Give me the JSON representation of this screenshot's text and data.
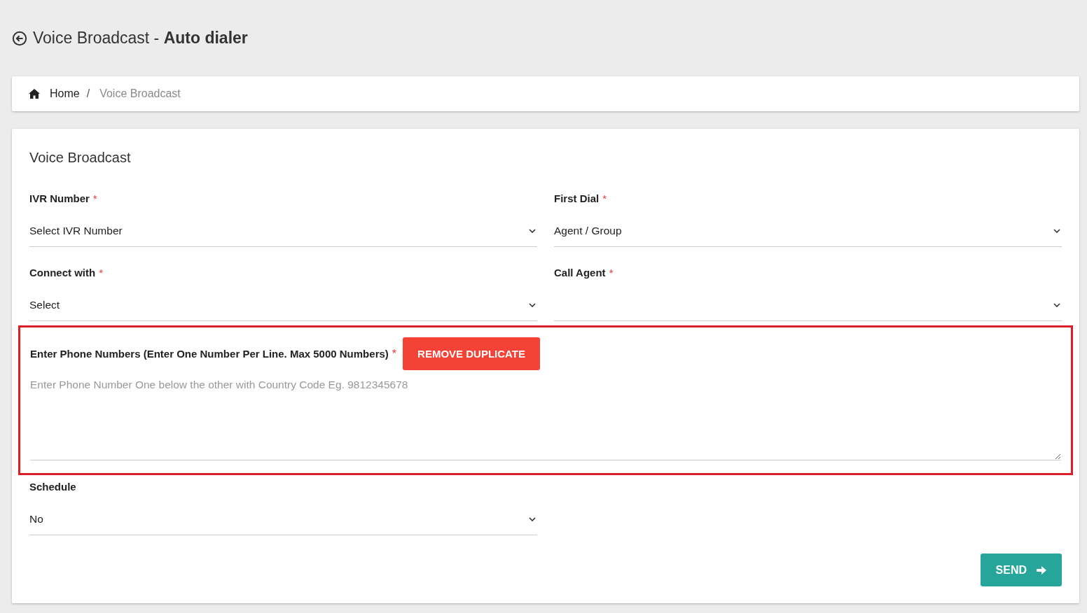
{
  "header": {
    "title_plain": "Voice Broadcast - ",
    "title_bold": "Auto dialer"
  },
  "breadcrumb": {
    "items": [
      {
        "label": "Home",
        "current": false
      },
      {
        "label": "Voice Broadcast",
        "current": true
      }
    ],
    "separator": "/"
  },
  "form": {
    "title": "Voice Broadcast",
    "fields": [
      {
        "label": "IVR Number",
        "required_mark": "*",
        "value": "Select IVR Number"
      },
      {
        "label": "First Dial",
        "required_mark": "*",
        "value": "Agent / Group"
      },
      {
        "label": "Connect with",
        "required_mark": "*",
        "value": "Select"
      },
      {
        "label": "Call Agent",
        "required_mark": "*"
      }
    ],
    "phone_numbers": {
      "label": "Enter Phone Numbers (Enter One Number Per Line. Max 5000 Numbers)",
      "required_mark": "*",
      "button": "REMOVE DUPLICATE",
      "placeholder": "Enter Phone Number One below the other with Country Code Eg. 9812345678",
      "highlighted": true
    },
    "schedule": {
      "label": "Schedule",
      "value": "No"
    },
    "submit": "SEND"
  }
}
